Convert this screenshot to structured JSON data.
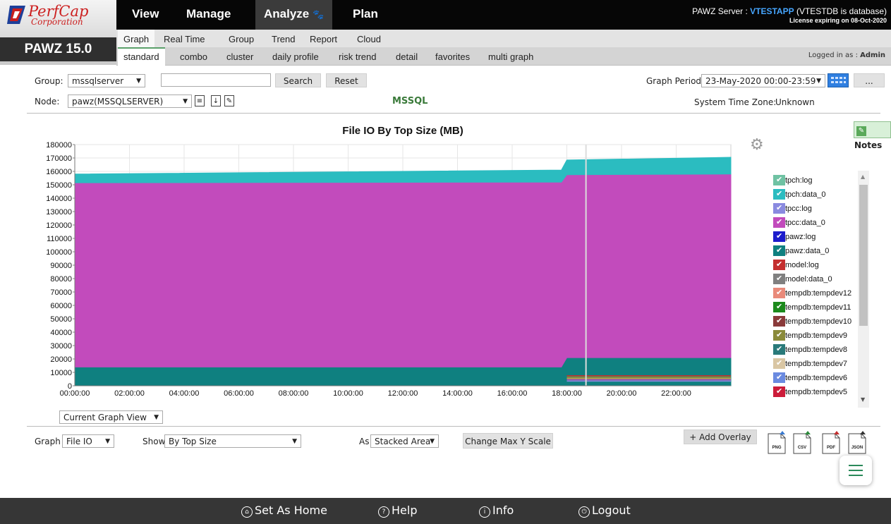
{
  "brand": {
    "logo_text": "PerfCap",
    "logo_sub": "Corporation",
    "version": "PAWZ 15.0"
  },
  "main_nav": [
    "View",
    "Manage",
    "Analyze",
    "Plan"
  ],
  "server": {
    "prefix": "PAWZ Server : ",
    "name": "VTESTAPP",
    "suffix": " (VTESTDB is database)",
    "license": "License expiring on 08-Oct-2020"
  },
  "sub_nav": [
    "Graph",
    "Real Time",
    "Group",
    "Trend",
    "Report",
    "Cloud"
  ],
  "graph_tabs": [
    "standard",
    "combo",
    "cluster",
    "daily profile",
    "risk trend",
    "detail",
    "favorites",
    "multi graph"
  ],
  "logged_in": {
    "label": "Logged in as : ",
    "user": "Admin"
  },
  "controls": {
    "group_label": "Group:",
    "group_value": "mssqlserver",
    "search_placeholder": "",
    "search_button": "Search",
    "reset_button": "Reset",
    "node_label": "Node:",
    "node_value": "pawz(MSSQLSERVER)",
    "db_label": "MSSQL",
    "period_label": "Graph Period:",
    "period_value": "23-May-2020 00:00-23:59",
    "more_button": "...",
    "timezone_label": "System Time Zone:",
    "timezone_value": "Unknown",
    "notes_button": "Notes",
    "view_select": "Current Graph View"
  },
  "bottom": {
    "graph_label": "Graph",
    "graph_value": "File IO",
    "show_label": "Show",
    "show_value": "By Top Size",
    "as_label": "As",
    "as_value": "Stacked Area",
    "max_y_button": "Change Max Y Scale",
    "overlay_button": "+ Add Overlay",
    "exports": [
      "PNG",
      "CSV",
      "PDF",
      "JSON"
    ]
  },
  "footer": [
    "Set As Home",
    "Help",
    "Info",
    "Logout"
  ],
  "chart_data": {
    "type": "area",
    "title": "File IO By Top Size (MB)",
    "x": [
      "00:00:00",
      "02:00:00",
      "04:00:00",
      "06:00:00",
      "08:00:00",
      "10:00:00",
      "12:00:00",
      "14:00:00",
      "16:00:00",
      "18:00:00",
      "20:00:00",
      "22:00:00"
    ],
    "y_ticks": [
      0,
      10000,
      20000,
      30000,
      40000,
      50000,
      60000,
      70000,
      80000,
      90000,
      100000,
      110000,
      120000,
      130000,
      140000,
      150000,
      160000,
      170000,
      180000
    ],
    "ylim": [
      0,
      180000
    ],
    "xlim_hours": [
      0,
      24
    ],
    "series_stacked": [
      {
        "name": "pawz:data_0",
        "color": "#0f8080",
        "x_hours": [
          0,
          17.8,
          18.0,
          24
        ],
        "values": [
          14000,
          14000,
          21000,
          21000
        ]
      },
      {
        "name": "tpcc:data_0",
        "color": "#c24bbc",
        "x_hours": [
          0,
          17.8,
          18.0,
          24
        ],
        "values": [
          137500,
          138000,
          136500,
          137000
        ]
      },
      {
        "name": "tpch:data_0",
        "color": "#2bbcc0",
        "x_hours": [
          0,
          17.8,
          18.0,
          24
        ],
        "values": [
          6500,
          9000,
          11000,
          12500
        ]
      }
    ],
    "legend": [
      {
        "name": "tpch:log",
        "color": "#6fc2a3"
      },
      {
        "name": "tpch:data_0",
        "color": "#2bbcc0"
      },
      {
        "name": "tpcc:log",
        "color": "#8a8ae0"
      },
      {
        "name": "tpcc:data_0",
        "color": "#c24bbc"
      },
      {
        "name": "pawz:log",
        "color": "#1c1ccc"
      },
      {
        "name": "pawz:data_0",
        "color": "#0f8080"
      },
      {
        "name": "model:log",
        "color": "#c42f2f"
      },
      {
        "name": "model:data_0",
        "color": "#808080"
      },
      {
        "name": "tempdb:tempdev12",
        "color": "#e98a7a"
      },
      {
        "name": "tempdb:tempdev11",
        "color": "#1c8a1c"
      },
      {
        "name": "tempdb:tempdev10",
        "color": "#8a3a3a"
      },
      {
        "name": "tempdb:tempdev9",
        "color": "#8a8a3a"
      },
      {
        "name": "tempdb:tempdev8",
        "color": "#2a7a7a"
      },
      {
        "name": "tempdb:tempdev7",
        "color": "#d9c6a3"
      },
      {
        "name": "tempdb:tempdev6",
        "color": "#6a8ae0"
      },
      {
        "name": "tempdb:tempdev5",
        "color": "#cc1c3a"
      }
    ],
    "grid": true
  }
}
